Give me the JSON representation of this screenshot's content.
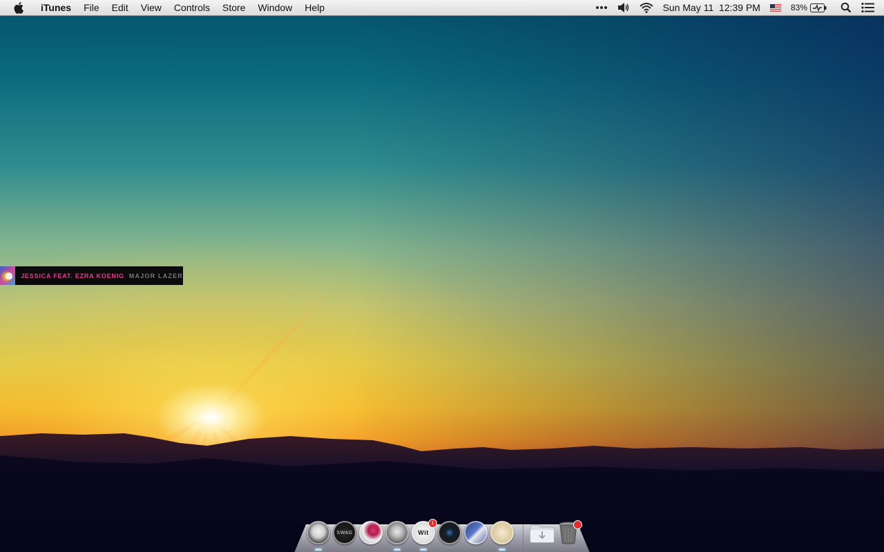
{
  "menubar": {
    "app_name": "iTunes",
    "menus": [
      "File",
      "Edit",
      "View",
      "Controls",
      "Store",
      "Window",
      "Help"
    ],
    "tray": {
      "more_icon": "more-dots-icon",
      "volume_icon": "volume-icon",
      "wifi_icon": "wifi-icon",
      "datetime": "Sun May 11  12:39 PM",
      "input_flag_icon": "us-flag-icon",
      "battery_percent": "83%",
      "battery_icon": "battery-charging-icon",
      "spotlight_icon": "search-icon",
      "notifications_icon": "notification-center-icon"
    }
  },
  "now_playing": {
    "title": "JESSICA FEAT. EZRA KOENIG",
    "artist": "MAJOR LAZER",
    "title_color": "#e43c8f",
    "artist_color": "#7a7a7a"
  },
  "dock": {
    "apps": [
      {
        "name": "dock-app-skull-bw",
        "label": "",
        "running": true,
        "badge": ""
      },
      {
        "name": "dock-app-swag-power",
        "label": "SWAG",
        "running": false,
        "badge": ""
      },
      {
        "name": "dock-app-pink-splash",
        "label": "",
        "running": false,
        "badge": ""
      },
      {
        "name": "dock-app-skull-glasses",
        "label": "",
        "running": true,
        "badge": ""
      },
      {
        "name": "dock-app-wit",
        "label": "Wit",
        "running": true,
        "badge": "1"
      },
      {
        "name": "dock-app-camera",
        "label": "",
        "running": false,
        "badge": ""
      },
      {
        "name": "dock-app-rocket",
        "label": "",
        "running": false,
        "badge": ""
      },
      {
        "name": "dock-app-fans",
        "label": "",
        "running": true,
        "badge": ""
      }
    ],
    "downloads_icon": "downloads-folder-icon",
    "trash_icon": "trash-icon"
  }
}
